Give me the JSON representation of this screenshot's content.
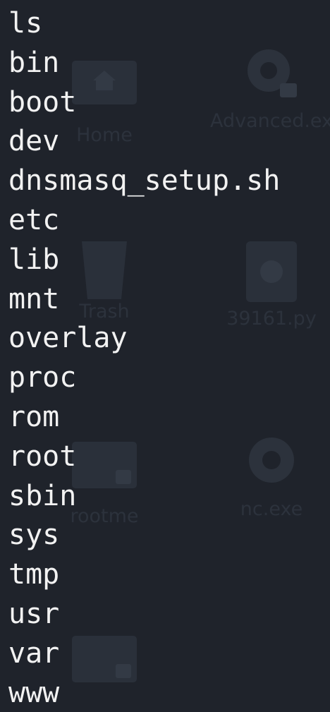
{
  "terminal": {
    "command": "ls",
    "output": [
      "bin",
      "boot",
      "dev",
      "dnsmasq_setup.sh",
      "etc",
      "lib",
      "mnt",
      "overlay",
      "proc",
      "rom",
      "root",
      "sbin",
      "sys",
      "tmp",
      "usr",
      "var",
      "www"
    ]
  },
  "desktop": {
    "icons": [
      {
        "label": "Home",
        "icon": "home-folder-icon"
      },
      {
        "label": "Advanced.ex",
        "icon": "gear-lock-icon"
      },
      {
        "label": "Trash",
        "icon": "trash-icon"
      },
      {
        "label": "39161.py",
        "icon": "python-file-icon"
      },
      {
        "label": "rootme",
        "icon": "locked-folder-icon"
      },
      {
        "label": "nc.exe",
        "icon": "gear-icon"
      },
      {
        "label": "",
        "icon": "locked-folder-icon"
      }
    ]
  },
  "colors": {
    "background": "#1f232b",
    "text": "#f2f2f2",
    "ghost_icon": "#2c323c"
  }
}
